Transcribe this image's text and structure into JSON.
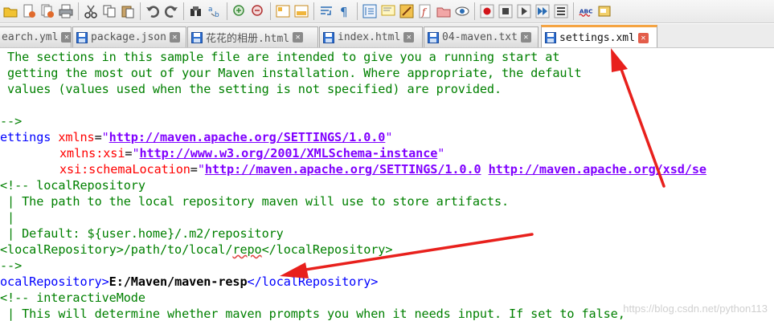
{
  "toolbar": {
    "icons": [
      "open-folder-icon",
      "close-file-icon",
      "close-all-icon",
      "print-icon",
      "cut-icon",
      "copy-icon",
      "paste-icon",
      "undo-icon",
      "redo-icon",
      "find-icon",
      "replace-icon",
      "zoom-in-icon",
      "zoom-out-icon",
      "sync-vertical-icon",
      "sync-horizontal-icon",
      "word-wrap-icon",
      "show-all-chars-icon",
      "indent-guide-icon",
      "document-map-icon",
      "function-list-icon",
      "folder-as-workspace-icon",
      "monitoring-icon",
      "record-macro-icon",
      "stop-macro-icon",
      "play-macro-icon",
      "run-macro-multiple-icon",
      "save-macro-icon",
      "spell-check-icon",
      "launch-icon"
    ],
    "spell_label": "ABC"
  },
  "tabs": [
    {
      "label": "earch.yml",
      "active": false
    },
    {
      "label": "package.json",
      "active": false
    },
    {
      "label": "花花的相册.html",
      "active": false
    },
    {
      "label": "index.html",
      "active": false
    },
    {
      "label": "04-maven.txt",
      "active": false
    },
    {
      "label": "settings.xml",
      "active": true
    }
  ],
  "editor": {
    "lines": [
      " The sections in this sample file are intended to give you a running start at",
      " getting the most out of your Maven installation. Where appropriate, the default",
      " values (values used when the setting is not specified) are provided.",
      "",
      "-->",
      "ettings",
      "xmlns",
      "http://maven.apache.org/SETTINGS/1.0.0",
      "xmlns:xsi",
      "http://www.w3.org/2001/XMLSchema-instance",
      "xsi:schemaLocation",
      "http://maven.apache.org/SETTINGS/1.0.0",
      "http://maven.apache.org/xsd/se",
      "<!-- localRepository",
      " | The path to the local repository maven will use to store artifacts.",
      " |",
      " | Default: ${user.home}/.m2/repository",
      "<localRepository>/path/to/local/",
      "repo",
      "</localRepository>",
      "-->",
      "ocalRepository",
      "E:/Maven/maven-resp",
      "/localRepository",
      "<!-- interactiveMode",
      " | This will determine whether maven prompts you when it needs input. If set to false,"
    ]
  },
  "colors": {
    "comment": "#008000",
    "tag": "#0000ff",
    "attribute": "#ff0000",
    "string": "#8000ff",
    "active_tab_accent": "#f5a442",
    "annotation_arrow": "#e8201c"
  },
  "watermark": "https://blog.csdn.net/python113"
}
